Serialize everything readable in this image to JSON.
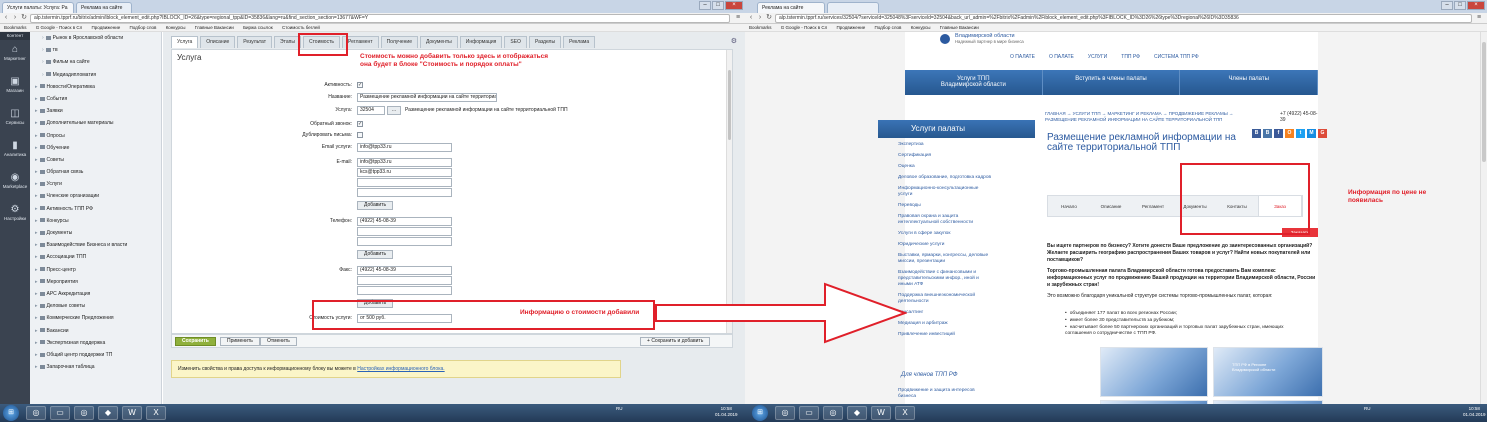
{
  "left": {
    "tabs": [
      "Услуги палаты: Услуга: Ра",
      "Реклама на сайте"
    ],
    "url": "alp.tstermin.tpprf.ru/bitrix/admin/iblock_element_edit.php?IBLOCK_ID=26&type=regional_tpp&ID=35836&lang=ru&find_section_section=13677&WF=Y",
    "bookmarks": [
      "Bookmarks",
      "G Google - Поиск в Сл",
      "Продвижение",
      "Подбор слов",
      "Конкурсы",
      "Главные Вакансии",
      "Биржа ссылок",
      "Стоимость беглей"
    ],
    "darknav": [
      {
        "icon": "stack-icon",
        "glyph": "▤",
        "label": "Контент",
        "top": true
      },
      {
        "icon": "shop-icon",
        "glyph": "⌂",
        "label": "Маркетинг"
      },
      {
        "icon": "box-icon",
        "glyph": "▣",
        "label": "Магазин"
      },
      {
        "icon": "services-icon",
        "glyph": "◫",
        "label": "Сервисы"
      },
      {
        "icon": "analytics-icon",
        "glyph": "▮",
        "label": "Аналитика"
      },
      {
        "icon": "marketplace-icon",
        "glyph": "◉",
        "label": "Marketplace"
      },
      {
        "icon": "settings-icon",
        "glyph": "⚙",
        "label": "Настройки"
      }
    ],
    "tree": [
      "Рынок в Ярославской области",
      "тв",
      "Фильм на сайте",
      "Медиадипломатия",
      "Новости/Оперативка",
      "События",
      "Заявки",
      "Дополнительные материалы",
      "Опросы",
      "Обучение",
      "Советы",
      "Обратная связь",
      "Услуги",
      "Членские организации",
      "Активность ТПП РФ",
      "Конкурсы",
      "Документы",
      "Взаимодействие Бизнеса и власти",
      "Ассоциации ТПП",
      "Пресс-центр",
      "Мероприятия",
      "АРС Аккредитация",
      "Деловые советы",
      "Коммерческие Предложения",
      "Вакансии",
      "Экспертизная поддержка",
      "Общий центр поддержки ТП",
      "Запарочная таблица"
    ],
    "form_tabs": [
      "Услуга",
      "Описание",
      "Результат",
      "Этапы",
      "Стоимость",
      "Регламент",
      "Получение",
      "Документы",
      "Информация",
      "SEO",
      "Разделы",
      "Реклама"
    ],
    "form_title": "Услуга",
    "fields": {
      "active_label": "Активность:",
      "name_label": "Название:",
      "name_value": "Размещение рекламной информации на сайте территориаль",
      "service_label": "Услуга:",
      "service_id": "32504",
      "service_text": "Размещение рекламной информации на сайте территориальной ТПП",
      "feedback_label": "Обратный звонок:",
      "dup_label": "Дублировать письма:",
      "email_label": "Email услуги:",
      "email_value": "info@tpp33.ru",
      "emails_label": "E-mail:",
      "emails": [
        "info@tpp33.ru",
        "kcs@tpp33.ru",
        "",
        ""
      ],
      "add_label": "Добавить",
      "phone_label": "Телефон:",
      "phones": [
        "(4922) 45-08-39",
        "",
        ""
      ],
      "fax_label": "Факс:",
      "faxes": [
        "(4922) 45-08-39",
        "",
        ""
      ],
      "price_label": "Стоимость услуги:",
      "price_value": "от 500 руб."
    },
    "buttons": {
      "save": "Сохранить",
      "apply": "Применить",
      "cancel": "Отменить",
      "save_add": "Сохранить и добавить"
    },
    "notice": {
      "text": "Изменить свойства и права доступа к информационному блоку вы можете в",
      "link": "Настройках информационного блока."
    }
  },
  "annotations": {
    "top": "Стоимость можно добавить только здесь и отображаться\nона будет в блоке \"Стоимость и порядок оплаты\"",
    "bottom": "Информацию о стоимости добавили",
    "right": "Информация по цене не\nпоявилась"
  },
  "right": {
    "tabs": [
      "Реклама на сайте",
      ""
    ],
    "url": "alp.tstermin.tpprf.ru/services/32504/?serviceId=325048%3Fserviceld=32504&back_url_admin=%2Fbitrix%2Fadmin%2Fiblock_element_edit.php%3FIBLOCK_ID%3D26%26type%3Dregional%26ID%3D35836",
    "logo": {
      "line1": "Владимирской области",
      "line2": "Надежный партнер в мире бизнеса"
    },
    "topmenu": [
      "О ПАЛАТЕ",
      "О ПАЛАТЕ",
      "УСЛУГИ",
      "ТПП РФ",
      "СИСТЕМА ТПП РФ"
    ],
    "bluemenu": [
      "Услуги ТПП\nВладимирской области",
      "Вступить в члены палаты",
      "Члены палаты"
    ],
    "side_header": "Услуги палаты",
    "side_items": [
      "Экспертиза",
      "Сертификация",
      "Оценка",
      "Деловое образование, подготовка кадров",
      "Информационно-консультационные услуги",
      "Переводы",
      "Правовая охрана и защита интеллектуальной собственности",
      "Услуги в сфере закупок",
      "Юридические услуги",
      "Выставки, ярмарки, конгрессы, деловые миссии, презентации",
      "Взаимодействие с финансовыми и представительскими инфор., иной и иными АТФ",
      "Поддержка внешнеэкономической деятельности",
      "Консалтинг",
      "Медиация и арбитраж",
      "Привлечение инвестиций"
    ],
    "side_header2": "Для членов ТПП РФ",
    "side_items2": [
      "Продвижение и защита интересов бизнеса"
    ],
    "crumbs": "ГЛАВНАЯ  →  УСЛУГИ ТПП  →  МАРКЕТИНГ И РЕКЛАМА  →  ПРОДВИЖЕНИЕ РЕКЛАМЫ  →  РАЗМЕЩЕНИЕ РЕКЛАМНОЙ ИНФОРМАЦИИ НА САЙТЕ ТЕРРИТОРИАЛЬНОЙ ТПП",
    "phone": "+7 (4922) 45-08-39",
    "title": "Размещение рекламной информации на сайте территориальной ТПП",
    "social": [
      {
        "t": "B",
        "c": "#3b5b98"
      },
      {
        "t": "В",
        "c": "#4a76a8"
      },
      {
        "t": "f",
        "c": "#3b5998"
      },
      {
        "t": "O",
        "c": "#f58220"
      },
      {
        "t": "t",
        "c": "#1da1f2"
      },
      {
        "t": "M",
        "c": "#168de2"
      },
      {
        "t": "G",
        "c": "#dd4b39"
      }
    ],
    "tabs_row": [
      "Начало",
      "Описание",
      "Регламент",
      "Документы",
      "Контакты",
      "Заказ"
    ],
    "order": "Заказать",
    "para1": "Вы ищете партнеров по бизнесу? Хотите донести Ваше предложение до заинтересованных организаций? Желаете расширить географию распространения Ваших товаров и услуг? Найти новых покупателей или поставщиков?",
    "para2": "Торгово-промышленная палата Владимирской области готова предоставить Вам комплекс информационных услуг по продвижению Вашей продукции на территории Владимирской области, России и зарубежных стран!",
    "para3": "Это возможно благодаря уникальной структуре системы торгово-промышленных палат, которая:",
    "bullets": [
      "объединяет 177 палат во всех регионах России;",
      "имеет более 30 представительств за рубежом;",
      "насчитывает более 50 партнерских организаций и торговых палат зарубежных стран, имеющих соглашения о сотрудничестве с ТПП РФ."
    ],
    "pic_caption": "ТПП РФ в Регионе\nВладимирской области"
  },
  "taskbar": {
    "lang": "RU",
    "time1": "10:58",
    "date1": "01.04.2019",
    "time2": "10:58",
    "date2": "01.04.2019"
  }
}
